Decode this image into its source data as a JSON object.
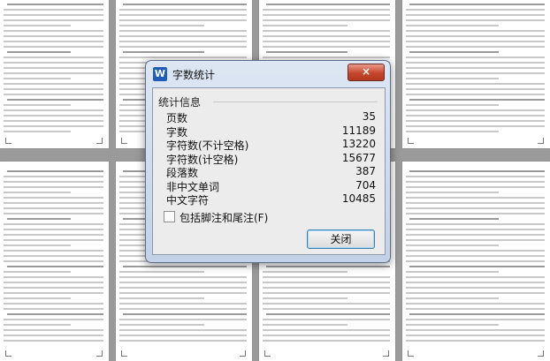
{
  "dialog": {
    "title": "字数统计",
    "app_icon_letter": "W",
    "close_glyph": "×",
    "group_title": "统计信息",
    "stats": [
      {
        "label": "页数",
        "value": "35"
      },
      {
        "label": "字数",
        "value": "11189"
      },
      {
        "label": "字符数(不计空格)",
        "value": "13220"
      },
      {
        "label": "字符数(计空格)",
        "value": "15677"
      },
      {
        "label": "段落数",
        "value": "387"
      },
      {
        "label": "非中文单词",
        "value": "704"
      },
      {
        "label": "中文字符",
        "value": "10485"
      }
    ],
    "checkbox_label": "包括脚注和尾注(F)",
    "close_button_label": "关闭"
  },
  "icons": {
    "app": "wps-writer-icon",
    "close": "close-icon"
  },
  "colors": {
    "app_icon": "#1f5db8",
    "close_button": "#c6452c",
    "button_border": "#3c7fb1"
  }
}
